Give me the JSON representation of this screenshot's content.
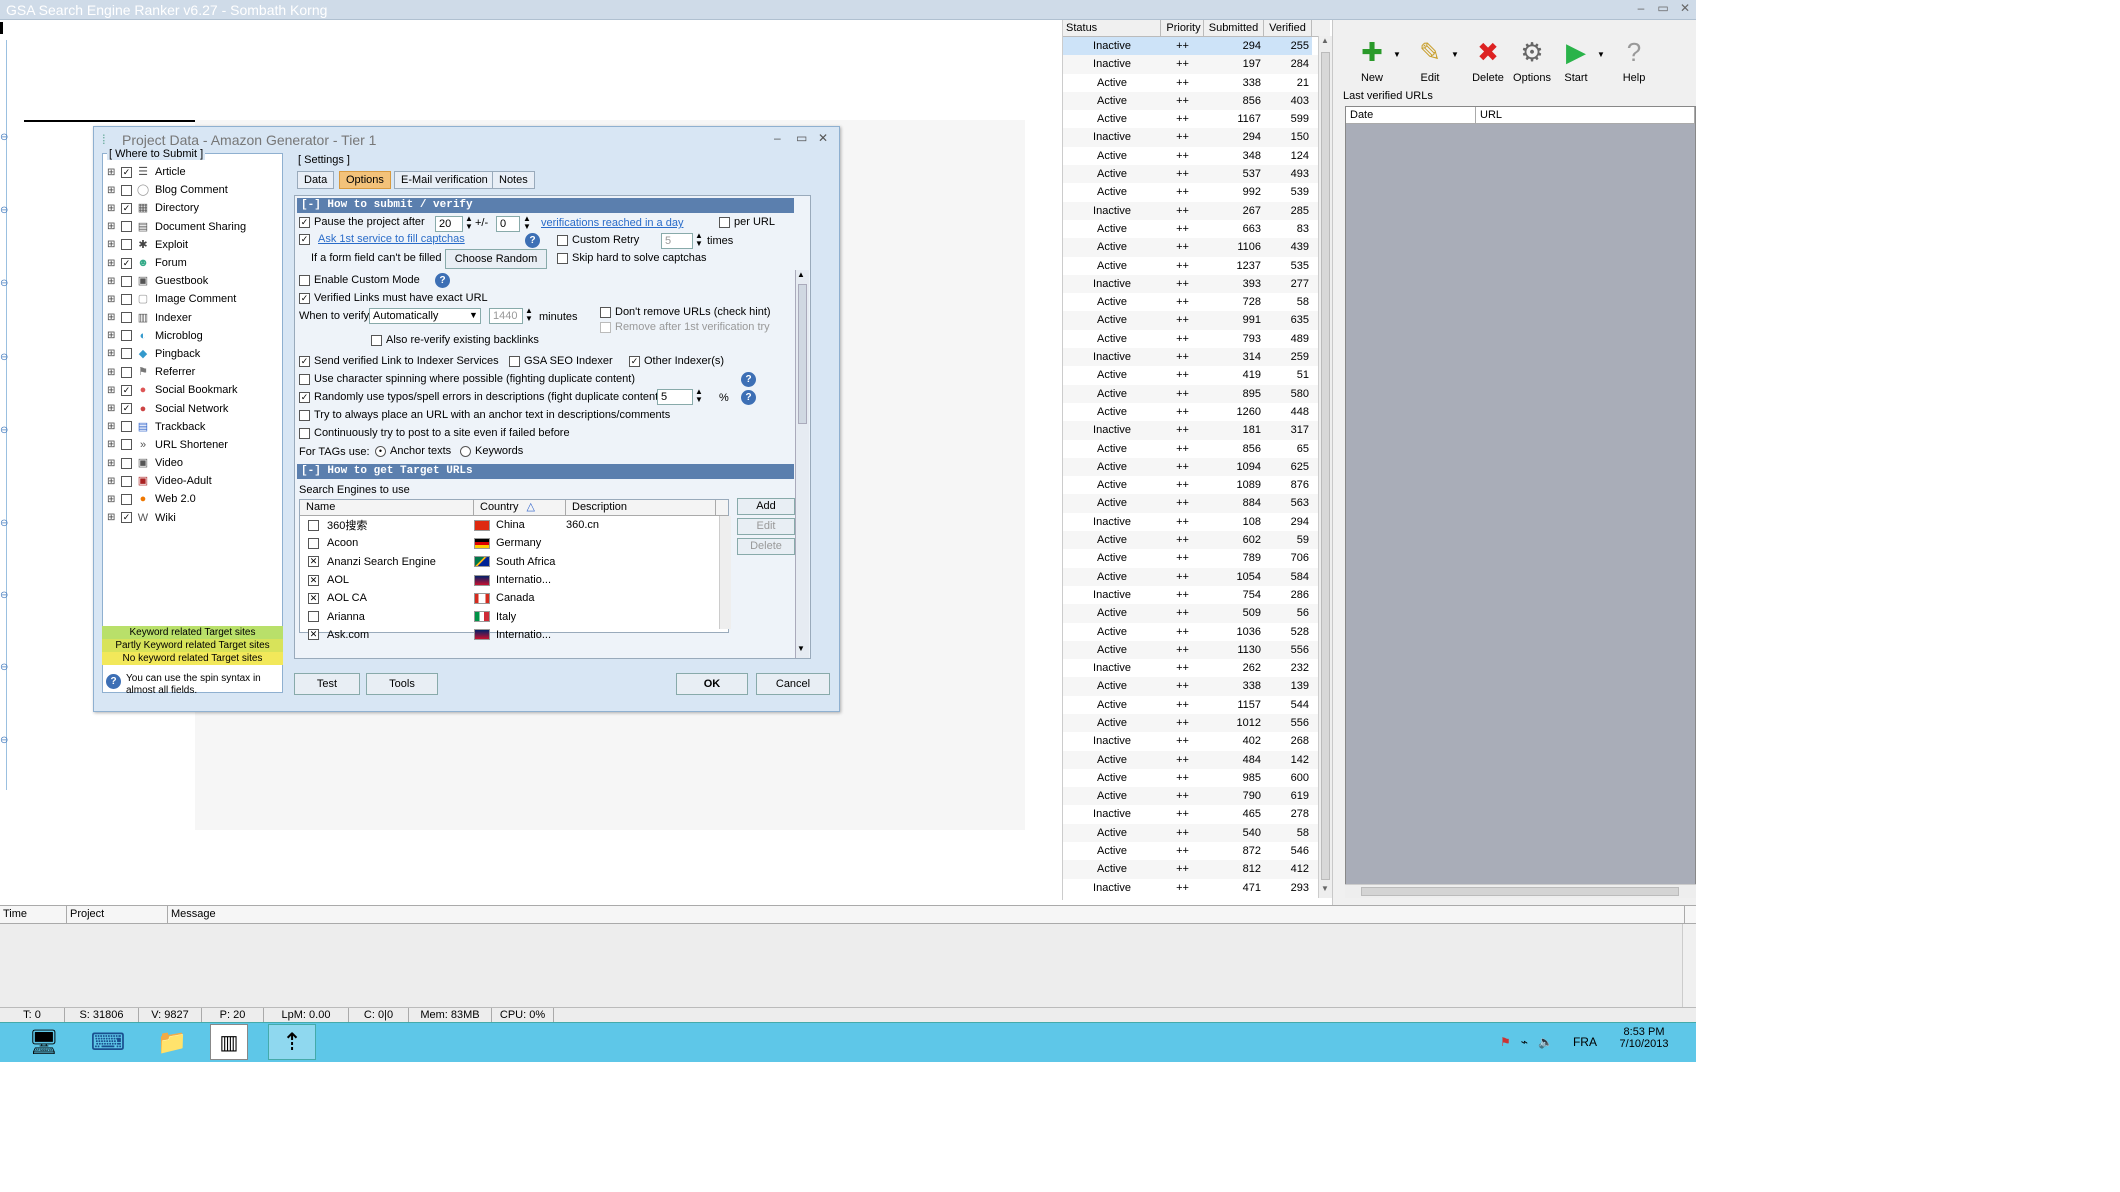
{
  "window": {
    "title": "GSA Search Engine Ranker v6.27 - Sombath Korng"
  },
  "status_table": {
    "headers": [
      "Status",
      "Priority",
      "Submitted",
      "Verified"
    ],
    "rows": [
      [
        "Inactive",
        "++",
        "294",
        "255"
      ],
      [
        "Inactive",
        "++",
        "197",
        "284"
      ],
      [
        "Active",
        "++",
        "338",
        "21"
      ],
      [
        "Active",
        "++",
        "856",
        "403"
      ],
      [
        "Active",
        "++",
        "1167",
        "599"
      ],
      [
        "Inactive",
        "++",
        "294",
        "150"
      ],
      [
        "Active",
        "++",
        "348",
        "124"
      ],
      [
        "Active",
        "++",
        "537",
        "493"
      ],
      [
        "Active",
        "++",
        "992",
        "539"
      ],
      [
        "Inactive",
        "++",
        "267",
        "285"
      ],
      [
        "Active",
        "++",
        "663",
        "83"
      ],
      [
        "Active",
        "++",
        "1106",
        "439"
      ],
      [
        "Active",
        "++",
        "1237",
        "535"
      ],
      [
        "Inactive",
        "++",
        "393",
        "277"
      ],
      [
        "Active",
        "++",
        "728",
        "58"
      ],
      [
        "Active",
        "++",
        "991",
        "635"
      ],
      [
        "Active",
        "++",
        "793",
        "489"
      ],
      [
        "Inactive",
        "++",
        "314",
        "259"
      ],
      [
        "Active",
        "++",
        "419",
        "51"
      ],
      [
        "Active",
        "++",
        "895",
        "580"
      ],
      [
        "Active",
        "++",
        "1260",
        "448"
      ],
      [
        "Inactive",
        "++",
        "181",
        "317"
      ],
      [
        "Active",
        "++",
        "856",
        "65"
      ],
      [
        "Active",
        "++",
        "1094",
        "625"
      ],
      [
        "Active",
        "++",
        "1089",
        "876"
      ],
      [
        "Active",
        "++",
        "884",
        "563"
      ],
      [
        "Inactive",
        "++",
        "108",
        "294"
      ],
      [
        "Active",
        "++",
        "602",
        "59"
      ],
      [
        "Active",
        "++",
        "789",
        "706"
      ],
      [
        "Active",
        "++",
        "1054",
        "584"
      ],
      [
        "Inactive",
        "++",
        "754",
        "286"
      ],
      [
        "Active",
        "++",
        "509",
        "56"
      ],
      [
        "Active",
        "++",
        "1036",
        "528"
      ],
      [
        "Active",
        "++",
        "1130",
        "556"
      ],
      [
        "Inactive",
        "++",
        "262",
        "232"
      ],
      [
        "Active",
        "++",
        "338",
        "139"
      ],
      [
        "Active",
        "++",
        "1157",
        "544"
      ],
      [
        "Active",
        "++",
        "1012",
        "556"
      ],
      [
        "Inactive",
        "++",
        "402",
        "268"
      ],
      [
        "Active",
        "++",
        "484",
        "142"
      ],
      [
        "Active",
        "++",
        "985",
        "600"
      ],
      [
        "Active",
        "++",
        "790",
        "619"
      ],
      [
        "Inactive",
        "++",
        "465",
        "278"
      ],
      [
        "Active",
        "++",
        "540",
        "58"
      ],
      [
        "Active",
        "++",
        "872",
        "546"
      ],
      [
        "Active",
        "++",
        "812",
        "412"
      ],
      [
        "Inactive",
        "++",
        "471",
        "293"
      ]
    ]
  },
  "toolbar": {
    "new": "New",
    "edit": "Edit",
    "delete": "Delete",
    "options": "Options",
    "start": "Start",
    "help": "Help"
  },
  "right": {
    "last_verified": "Last verified URLs",
    "col_date": "Date",
    "col_url": "URL"
  },
  "log": {
    "col_time": "Time",
    "col_project": "Project",
    "col_message": "Message"
  },
  "statusbar": {
    "t": "T: 0",
    "s": "S: 31806",
    "v": "V: 9827",
    "p": "P: 20",
    "lpm": "LpM: 0.00",
    "c": "C: 0|0",
    "mem": "Mem: 83MB",
    "cpu": "CPU: 0%"
  },
  "taskbar": {
    "lang": "FRA",
    "time": "8:53 PM",
    "date": "7/10/2013"
  },
  "dialog": {
    "title": "Project Data - Amazon Generator - Tier 1",
    "where_label": "[ Where to Submit ]",
    "settings_label": "[ Settings ]",
    "tabs": [
      "Data",
      "Options",
      "E-Mail verification",
      "Notes"
    ],
    "tree": [
      {
        "label": "Article",
        "checked": true
      },
      {
        "label": "Blog Comment",
        "checked": false
      },
      {
        "label": "Directory",
        "checked": true
      },
      {
        "label": "Document Sharing",
        "checked": false
      },
      {
        "label": "Exploit",
        "checked": false
      },
      {
        "label": "Forum",
        "checked": true
      },
      {
        "label": "Guestbook",
        "checked": false
      },
      {
        "label": "Image Comment",
        "checked": false
      },
      {
        "label": "Indexer",
        "checked": false
      },
      {
        "label": "Microblog",
        "checked": false
      },
      {
        "label": "Pingback",
        "checked": false
      },
      {
        "label": "Referrer",
        "checked": false
      },
      {
        "label": "Social Bookmark",
        "checked": true
      },
      {
        "label": "Social Network",
        "checked": true
      },
      {
        "label": "Trackback",
        "checked": false
      },
      {
        "label": "URL Shortener",
        "checked": false
      },
      {
        "label": "Video",
        "checked": false
      },
      {
        "label": "Video-Adult",
        "checked": false
      },
      {
        "label": "Web 2.0",
        "checked": false
      },
      {
        "label": "Wiki",
        "checked": true
      }
    ],
    "legend": {
      "keyword": "Keyword related Target sites",
      "partly": "Partly Keyword related Target sites",
      "no": "No keyword related Target sites"
    },
    "spin_hint": "You can use the spin syntax in almost all fields.",
    "sec1": "[-] How to submit / verify",
    "pause": "Pause the project after",
    "pause_val": "20",
    "plusminus": "+/-",
    "pm_val": "0",
    "verif_link": "verifications reached in a day",
    "per_url": "per URL",
    "ask_captcha": "Ask 1st service to fill captchas",
    "custom_retry": "Custom Retry",
    "retry_val": "5",
    "times": "times",
    "form_field": "If a form field can't be filled",
    "choose_random": "Choose Random",
    "skip_hard": "Skip hard to solve captchas",
    "custom_mode": "Enable Custom Mode",
    "exact_url": "Verified Links must have exact URL",
    "when_verify": "When to verify",
    "verify_sel": "Automatically",
    "minutes_val": "1440",
    "minutes": "minutes",
    "dont_remove": "Don't remove URLs (check hint)",
    "remove_after": "Remove after 1st verification try",
    "reverify": "Also re-verify existing backlinks",
    "send_indexer": "Send verified Link to Indexer Services",
    "gsa_seo": "GSA SEO Indexer",
    "other_idx": "Other Indexer(s)",
    "char_spin": "Use character spinning where possible (fighting duplicate content)",
    "typos": "Randomly use typos/spell errors in descriptions (fight duplicate content)",
    "typos_val": "5",
    "pct": "%",
    "anchor_url": "Try to always place an URL with an anchor text in descriptions/comments",
    "continuous": "Continuously try to post to a site even if failed before",
    "for_tags": "For TAGs use:",
    "anchor_texts": "Anchor texts",
    "keywords": "Keywords",
    "sec2": "[-] How to get Target URLs",
    "se_to_use": "Search Engines to use",
    "se_cols": [
      "Name",
      "Country",
      "Description"
    ],
    "se_rows": [
      {
        "name": "360搜索",
        "country": "China",
        "desc": "360.cn",
        "checked": false
      },
      {
        "name": "Acoon",
        "country": "Germany",
        "desc": "",
        "checked": false
      },
      {
        "name": "Ananzi Search Engine",
        "country": "South Africa",
        "desc": "",
        "checked": true
      },
      {
        "name": "AOL",
        "country": "Internatio...",
        "desc": "",
        "checked": true
      },
      {
        "name": "AOL CA",
        "country": "Canada",
        "desc": "",
        "checked": true
      },
      {
        "name": "Arianna",
        "country": "Italy",
        "desc": "",
        "checked": false
      },
      {
        "name": "Ask.com",
        "country": "Internatio...",
        "desc": "",
        "checked": true
      }
    ],
    "se_add": "Add",
    "se_edit": "Edit",
    "se_delete": "Delete",
    "btn_test": "Test",
    "btn_tools": "Tools",
    "btn_ok": "OK",
    "btn_cancel": "Cancel"
  },
  "colors": {
    "accent_tab": "#f3c27a",
    "section_header": "#5b7fae",
    "taskbar": "#5ec7e8",
    "legend_green": "#b9e06a",
    "legend_yellow": "#f2e85a"
  }
}
